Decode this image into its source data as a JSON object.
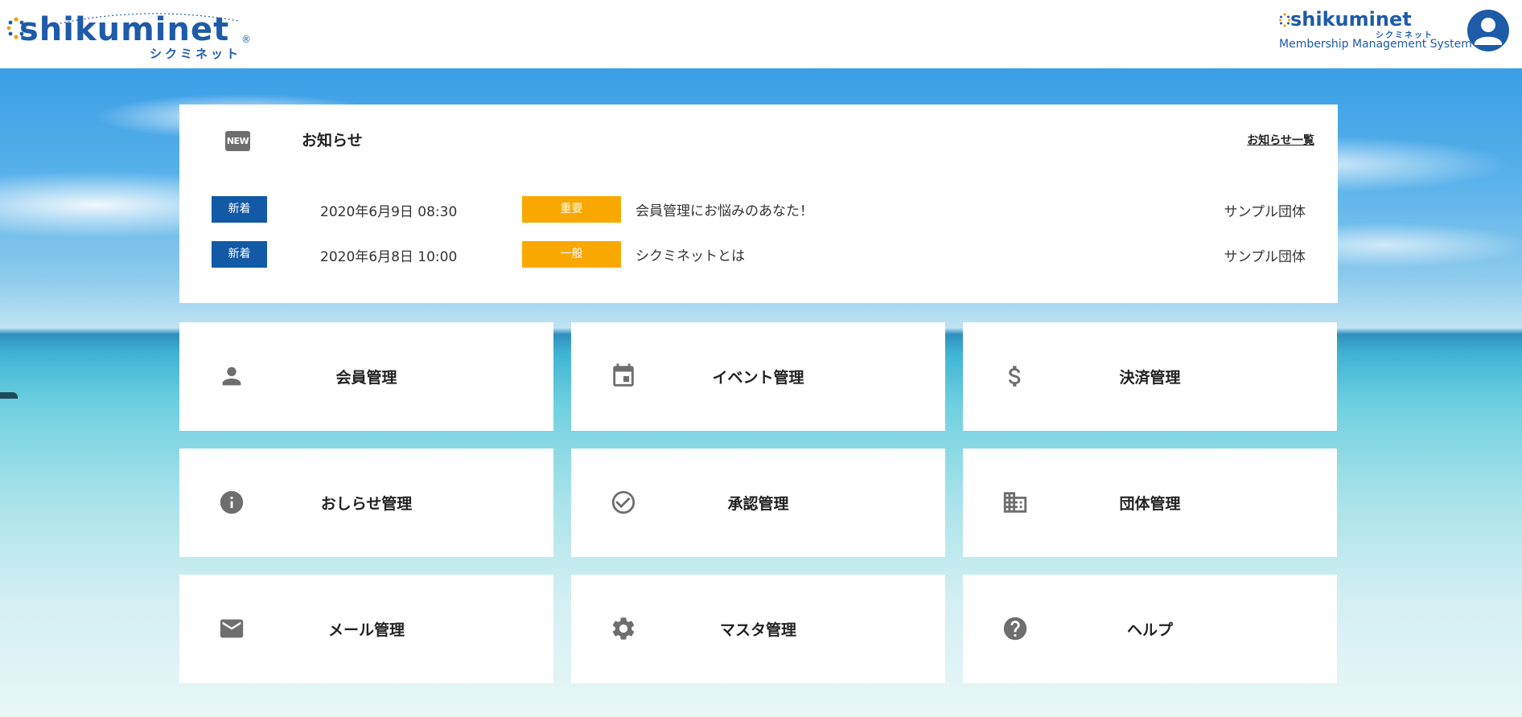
{
  "header": {
    "logo": {
      "text": "shikuminet",
      "kana": "シクミネット",
      "reg": "®"
    },
    "system_logo": {
      "text": "shikuminet",
      "kana": "シクミネット",
      "caption": "Membership Management System"
    },
    "avatar_icon": "user-icon"
  },
  "news": {
    "icon_text": "NEW",
    "title": "お知らせ",
    "all_link": "お知らせ一覧",
    "items": [
      {
        "badge": "新着",
        "date": "2020年6月9日 08:30",
        "category": "重要",
        "subject": "会員管理にお悩みのあなた！",
        "org": "サンプル団体"
      },
      {
        "badge": "新着",
        "date": "2020年6月8日 10:00",
        "category": "一般",
        "subject": "シクミネットとは",
        "org": "サンプル団体"
      }
    ]
  },
  "menu": [
    {
      "label": "会員管理",
      "icon": "person-icon"
    },
    {
      "label": "イベント管理",
      "icon": "calendar-icon"
    },
    {
      "label": "決済管理",
      "icon": "dollar-icon"
    },
    {
      "label": "おしらせ管理",
      "icon": "info-icon"
    },
    {
      "label": "承認管理",
      "icon": "check-circle-icon"
    },
    {
      "label": "団体管理",
      "icon": "building-icon"
    },
    {
      "label": "メール管理",
      "icon": "mail-icon"
    },
    {
      "label": "マスタ管理",
      "icon": "gear-icon"
    },
    {
      "label": "ヘルプ",
      "icon": "help-icon"
    }
  ],
  "colors": {
    "brand": "#1e5ba8",
    "new_badge": "#1259a6",
    "category_badge": "#f9a800",
    "icon_gray": "#6e6e6e"
  }
}
